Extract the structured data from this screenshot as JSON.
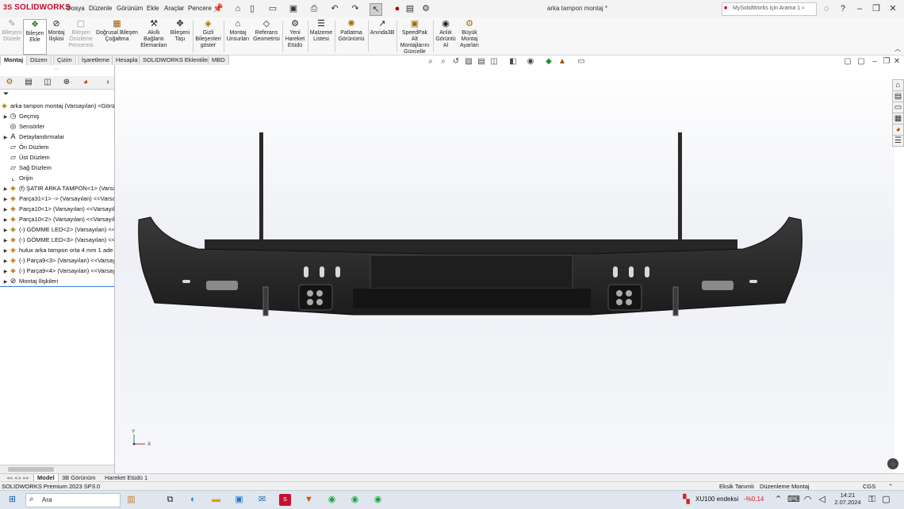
{
  "app": {
    "logo": "SOLIDWORKS",
    "title": "arka tampon montaj *",
    "menu": [
      "Dosya",
      "Düzenle",
      "Görünüm",
      "Ekle",
      "Araçlar",
      "Pencere"
    ],
    "search_placeholder": "MySolidWorks için Arama 1"
  },
  "commands": [
    {
      "label": "Bileşeni Düzele",
      "disabled": true,
      "icon": "edit-component-icon"
    },
    {
      "label": "Bileşen Ekle",
      "disabled": false,
      "icon": "insert-component-icon"
    },
    {
      "label": "Montaj İlişkisi",
      "disabled": false,
      "icon": "mate-icon"
    },
    {
      "label": "Bileşen Önizleme Penceresi",
      "disabled": true,
      "icon": "preview-window-icon"
    },
    {
      "label": "Doğrusal Bileşen Çoğaltma",
      "disabled": false,
      "icon": "linear-pattern-icon"
    },
    {
      "label": "Akıllı Bağlantı Elemanları",
      "disabled": false,
      "icon": "smart-fasteners-icon"
    },
    {
      "label": "Bileşeni Taşı",
      "disabled": false,
      "icon": "move-component-icon"
    },
    {
      "label": "Gizli Bileşenleri göster",
      "disabled": false,
      "icon": "show-hidden-icon"
    },
    {
      "label": "Montaj Unsurları",
      "disabled": false,
      "icon": "assembly-features-icon"
    },
    {
      "label": "Referans Geometrisi",
      "disabled": false,
      "icon": "reference-geometry-icon"
    },
    {
      "label": "Yeni Hareket Etüdü",
      "disabled": false,
      "icon": "motion-study-icon"
    },
    {
      "label": "Malzeme Listesi",
      "disabled": false,
      "icon": "bom-icon"
    },
    {
      "label": "Patlatma Görünümü",
      "disabled": false,
      "icon": "exploded-view-icon"
    },
    {
      "label": "Anında3B",
      "disabled": false,
      "icon": "instant3d-icon"
    },
    {
      "label": "SpeedPak Alt Montajlarını Güncelle",
      "disabled": false,
      "icon": "speedpak-icon"
    },
    {
      "label": "Anlık Görüntü Al",
      "disabled": false,
      "icon": "snapshot-icon"
    },
    {
      "label": "Büyük Montaj Ayarları",
      "disabled": false,
      "icon": "large-assembly-icon"
    }
  ],
  "tabs": [
    "Montaj",
    "Düzen",
    "Çizim",
    "İşaretleme",
    "Hesapla",
    "SOLIDWORKS Eklentileri",
    "MBD"
  ],
  "tree": {
    "root": "arka tampon montaj (Varsayılan) <Görün",
    "items": [
      {
        "label": "Geçmiş",
        "arrow": true,
        "icon": "history-icon"
      },
      {
        "label": "Sensörler",
        "arrow": false,
        "icon": "sensor-icon"
      },
      {
        "label": "Detaylandırmalar",
        "arrow": true,
        "icon": "annotations-icon"
      },
      {
        "label": "Ön Düzlem",
        "arrow": false,
        "icon": "plane-icon"
      },
      {
        "label": "Üst Düzlem",
        "arrow": false,
        "icon": "plane-icon"
      },
      {
        "label": "Sağ Düzlem",
        "arrow": false,
        "icon": "plane-icon"
      },
      {
        "label": "Orijin",
        "arrow": false,
        "icon": "origin-icon"
      },
      {
        "label": "(f) ŞATIR ARKA TAMPON<1> (Varsa",
        "arrow": true,
        "icon": "part-icon"
      },
      {
        "label": "Parça31<1> -> (Varsayılan) <<Varsa",
        "arrow": true,
        "icon": "part-icon"
      },
      {
        "label": "Parça10<1> (Varsayılan) <<Varsayıla",
        "arrow": true,
        "icon": "part-icon"
      },
      {
        "label": "Parça10<2> (Varsayılan) <<Varsayıla",
        "arrow": true,
        "icon": "part-icon"
      },
      {
        "label": "(-) GÖMME LED<2> (Varsayılan) <<",
        "arrow": true,
        "icon": "part-icon"
      },
      {
        "label": "(-) GÖMME LED<3> (Varsayılan) <<",
        "arrow": true,
        "icon": "part-icon"
      },
      {
        "label": "hulux arka tampon orta 4 mm 1 ade",
        "arrow": true,
        "icon": "part-icon"
      },
      {
        "label": "(-) Parça9<3> (Varsayılan) <<Varsay",
        "arrow": true,
        "icon": "part-icon"
      },
      {
        "label": "(-) Parça9<4> (Varsayılan) <<Varsay",
        "arrow": true,
        "icon": "part-icon"
      },
      {
        "label": "Montaj İlişkileri",
        "arrow": true,
        "icon": "mates-folder-icon"
      }
    ]
  },
  "bottom_tabs": [
    "Model",
    "3B Görünüm",
    "Hareket Etüdü 1"
  ],
  "status": {
    "product": "SOLIDWORKS Premium 2023 SP3.0",
    "mode1": "Eksik Tanımlı",
    "mode2": "Düzenleme Montaj",
    "units": "CGS"
  },
  "taskbar": {
    "search": "Ara",
    "stock_name": "XU100 endeksi",
    "stock_change": "-%0,14",
    "time": "14:21",
    "date": "2.07.2024"
  },
  "colors": {
    "accent": "#c8102e",
    "part": "#2a2a2a",
    "stock_down": "#d92020"
  }
}
